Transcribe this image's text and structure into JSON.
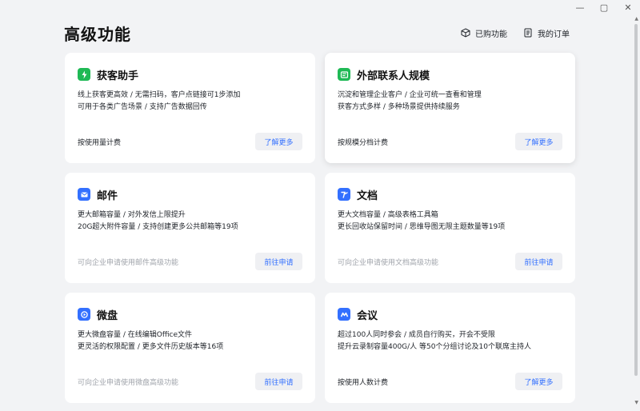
{
  "window": {
    "minimize_glyph": "—",
    "maximize_glyph": "▢",
    "close_glyph": "✕"
  },
  "header": {
    "title": "高级功能",
    "purchased_label": "已购功能",
    "orders_label": "我的订单"
  },
  "colors": {
    "green": "#1fb955",
    "blue": "#3370ff",
    "link": "#3370ff"
  },
  "cards": [
    {
      "title": "获客助手",
      "icon": "bolt-icon",
      "icon_color": "#1fb955",
      "lines": [
        "线上获客更高效 / 无需扫码，客户点链接可1步添加",
        "可用于各类广告场景 / 支持广告数据回传"
      ],
      "footer": "按使用量计费",
      "button": "了解更多"
    },
    {
      "title": "外部联系人规模",
      "icon": "contacts-icon",
      "icon_color": "#1fb955",
      "lines": [
        "沉淀和管理企业客户 / 企业可统一查看和管理",
        "获客方式多样 / 多种场景提供持续服务"
      ],
      "footer": "按规模分档计费",
      "button": "了解更多"
    },
    {
      "title": "邮件",
      "icon": "mail-icon",
      "icon_color": "#3370ff",
      "lines": [
        "更大邮箱容量 / 对外发信上限提升",
        "20G超大附件容量 / 支持创建更多公共邮箱等19项"
      ],
      "footer": "可向企业申请使用邮件高级功能",
      "button": "前往申请"
    },
    {
      "title": "文档",
      "icon": "document-icon",
      "icon_color": "#3370ff",
      "lines": [
        "更大文档容量 / 高级表格工具箱",
        "更长回收站保留时间 / 思维导图无限主题数量等19项"
      ],
      "footer": "可向企业申请使用文档高级功能",
      "button": "前往申请"
    },
    {
      "title": "微盘",
      "icon": "drive-icon",
      "icon_color": "#3370ff",
      "lines": [
        "更大微盘容量 / 在线编辑Office文件",
        "更灵活的权限配置 / 更多文件历史版本等16项"
      ],
      "footer": "可向企业申请使用微盘高级功能",
      "button": "前往申请"
    },
    {
      "title": "会议",
      "icon": "meeting-icon",
      "icon_color": "#3370ff",
      "lines": [
        "超过100人同时参会 / 成员自行购买，开会不受限",
        "提升云录制容量400G/人 等50个分组讨论及10个联席主持人"
      ],
      "footer": "按使用人数计费",
      "button": "了解更多"
    }
  ]
}
